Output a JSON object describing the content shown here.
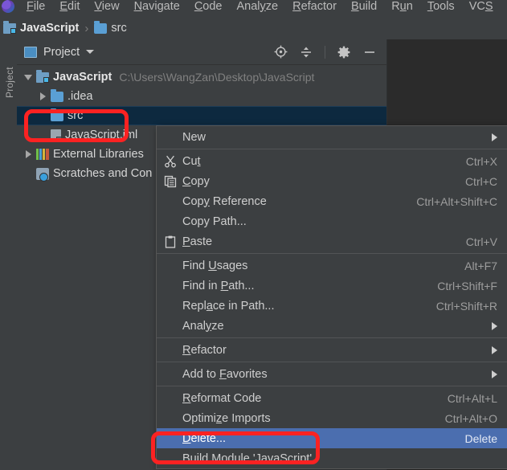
{
  "window": {
    "theme_background": "#3c3f41",
    "editor_background": "#2b2b2b",
    "accent_selection": "#4b6eaf",
    "tree_selection": "#0d293f",
    "annotation_color": "#fb2222"
  },
  "menubar": {
    "items": [
      {
        "label": "File",
        "mnemonic": "F"
      },
      {
        "label": "Edit",
        "mnemonic": "E"
      },
      {
        "label": "View",
        "mnemonic": "V"
      },
      {
        "label": "Navigate",
        "mnemonic": "N"
      },
      {
        "label": "Code",
        "mnemonic": "C"
      },
      {
        "label": "Analyze",
        "mnemonic": "y"
      },
      {
        "label": "Refactor",
        "mnemonic": "R"
      },
      {
        "label": "Build",
        "mnemonic": "B"
      },
      {
        "label": "Run",
        "mnemonic": "u"
      },
      {
        "label": "Tools",
        "mnemonic": "T"
      },
      {
        "label": "VCS",
        "mnemonic": "S"
      }
    ]
  },
  "breadcrumb": {
    "project": "JavaScript",
    "separator": "›",
    "folder": "src"
  },
  "toolwindow": {
    "vertical_tab_label": "Project",
    "title": "Project",
    "actions": [
      {
        "name": "locate-file-icon",
        "tooltip": "Select Opened File"
      },
      {
        "name": "collapse-all-icon",
        "tooltip": "Collapse All"
      },
      {
        "name": "gear-icon",
        "tooltip": "Settings"
      },
      {
        "name": "minimize-icon",
        "tooltip": "Hide"
      }
    ]
  },
  "tree": {
    "nodes": [
      {
        "label": "JavaScript",
        "path": "C:\\Users\\WangZan\\Desktop\\JavaScript",
        "icon": "module-icon",
        "twisty": "down",
        "bold": true,
        "indent": 0,
        "selected": false
      },
      {
        "label": ".idea",
        "path": "",
        "icon": "folder-icon",
        "twisty": "right",
        "bold": false,
        "indent": 1,
        "selected": false
      },
      {
        "label": "src",
        "path": "",
        "icon": "folder-icon",
        "twisty": "none",
        "bold": false,
        "indent": 1,
        "selected": true
      },
      {
        "label": "JavaScript.iml",
        "path": "",
        "icon": "file-icon",
        "twisty": "none",
        "bold": false,
        "indent": 1,
        "selected": false
      },
      {
        "label": "External Libraries",
        "path": "",
        "icon": "library-icon",
        "twisty": "right",
        "bold": false,
        "indent": 0,
        "selected": false
      },
      {
        "label": "Scratches and Con",
        "path": "",
        "icon": "scratches-icon",
        "twisty": "none",
        "bold": false,
        "indent": 0,
        "selected": false
      }
    ]
  },
  "context_menu": {
    "items": [
      {
        "type": "item",
        "label": "New",
        "mnemonic": "",
        "accel": "",
        "submenu": true,
        "icon": "",
        "highlight": false
      },
      {
        "type": "separator"
      },
      {
        "type": "item",
        "label": "Cut",
        "mnemonic": "t",
        "accel": "Ctrl+X",
        "submenu": false,
        "icon": "cut-icon",
        "highlight": false
      },
      {
        "type": "item",
        "label": "Copy",
        "mnemonic": "C",
        "accel": "Ctrl+C",
        "submenu": false,
        "icon": "copy-icon",
        "highlight": false
      },
      {
        "type": "item",
        "label": "Copy Reference",
        "mnemonic": "y",
        "accel": "Ctrl+Alt+Shift+C",
        "submenu": false,
        "icon": "",
        "highlight": false
      },
      {
        "type": "item",
        "label": "Copy Path...",
        "mnemonic": "",
        "accel": "",
        "submenu": false,
        "icon": "",
        "highlight": false
      },
      {
        "type": "item",
        "label": "Paste",
        "mnemonic": "P",
        "accel": "Ctrl+V",
        "submenu": false,
        "icon": "paste-icon",
        "highlight": false
      },
      {
        "type": "separator"
      },
      {
        "type": "item",
        "label": "Find Usages",
        "mnemonic": "U",
        "accel": "Alt+F7",
        "submenu": false,
        "icon": "",
        "highlight": false
      },
      {
        "type": "item",
        "label": "Find in Path...",
        "mnemonic": "P",
        "accel": "Ctrl+Shift+F",
        "submenu": false,
        "icon": "",
        "highlight": false
      },
      {
        "type": "item",
        "label": "Replace in Path...",
        "mnemonic": "a",
        "accel": "Ctrl+Shift+R",
        "submenu": false,
        "icon": "",
        "highlight": false
      },
      {
        "type": "item",
        "label": "Analyze",
        "mnemonic": "y",
        "accel": "",
        "submenu": true,
        "icon": "",
        "highlight": false
      },
      {
        "type": "separator"
      },
      {
        "type": "item",
        "label": "Refactor",
        "mnemonic": "R",
        "accel": "",
        "submenu": true,
        "icon": "",
        "highlight": false
      },
      {
        "type": "separator"
      },
      {
        "type": "item",
        "label": "Add to Favorites",
        "mnemonic": "F",
        "accel": "",
        "submenu": true,
        "icon": "",
        "highlight": false
      },
      {
        "type": "separator"
      },
      {
        "type": "item",
        "label": "Reformat Code",
        "mnemonic": "R",
        "accel": "Ctrl+Alt+L",
        "submenu": false,
        "icon": "",
        "highlight": false
      },
      {
        "type": "item",
        "label": "Optimize Imports",
        "mnemonic": "z",
        "accel": "Ctrl+Alt+O",
        "submenu": false,
        "icon": "",
        "highlight": false
      },
      {
        "type": "item",
        "label": "Delete...",
        "mnemonic": "D",
        "accel": "Delete",
        "submenu": false,
        "icon": "",
        "highlight": true
      },
      {
        "type": "item",
        "label": "Build Module 'JavaScript'",
        "mnemonic": "",
        "accel": "",
        "submenu": false,
        "icon": "",
        "highlight": false
      }
    ]
  },
  "annotations": [
    {
      "name": "annotation-src-box",
      "target": "src folder tree row"
    },
    {
      "name": "annotation-delete-box",
      "target": "Delete... menu item"
    }
  ]
}
